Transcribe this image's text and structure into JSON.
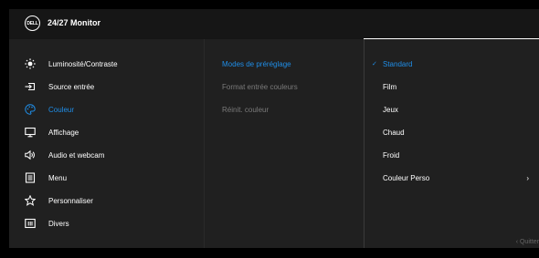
{
  "header": {
    "logo_text": "DELL",
    "title": "24/27 Monitor"
  },
  "menu": [
    {
      "label": "Luminosité/Contraste",
      "icon": "brightness-icon"
    },
    {
      "label": "Source entrée",
      "icon": "input-source-icon"
    },
    {
      "label": "Couleur",
      "icon": "color-palette-icon",
      "active": true
    },
    {
      "label": "Affichage",
      "icon": "display-icon"
    },
    {
      "label": "Audio et webcam",
      "icon": "speaker-icon"
    },
    {
      "label": "Menu",
      "icon": "menu-icon"
    },
    {
      "label": "Personnaliser",
      "icon": "star-icon"
    },
    {
      "label": "Divers",
      "icon": "info-icon"
    }
  ],
  "submenu": [
    {
      "label": "Modes de préréglage",
      "state": "active"
    },
    {
      "label": "Format entrée couleurs",
      "state": "dim"
    },
    {
      "label": "Réinit. couleur",
      "state": "dim"
    }
  ],
  "options": [
    {
      "label": "Standard",
      "selected": true
    },
    {
      "label": "Film"
    },
    {
      "label": "Jeux"
    },
    {
      "label": "Chaud"
    },
    {
      "label": "Froid"
    },
    {
      "label": "Couleur Perso",
      "has_submenu": true
    }
  ],
  "footer": {
    "quit_label": "Quitter"
  },
  "colors": {
    "accent": "#1f8ee8",
    "header_bg": "#161616",
    "panel_bg": "#202020"
  }
}
